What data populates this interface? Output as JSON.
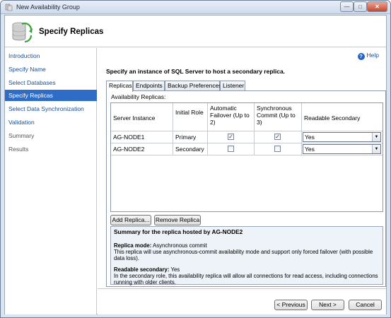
{
  "window": {
    "title": "New Availability Group"
  },
  "header": {
    "title": "Specify Replicas"
  },
  "sidebar": {
    "items": [
      {
        "label": "Introduction"
      },
      {
        "label": "Specify Name"
      },
      {
        "label": "Select Databases"
      },
      {
        "label": "Specify Replicas"
      },
      {
        "label": "Select Data Synchronization"
      },
      {
        "label": "Validation"
      },
      {
        "label": "Summary"
      },
      {
        "label": "Results"
      }
    ],
    "active_item": "Specify Replicas"
  },
  "help": {
    "label": "Help"
  },
  "main": {
    "instruction": "Specify an instance of SQL Server to host a secondary replica.",
    "tabs": [
      {
        "label": "Replicas"
      },
      {
        "label": "Endpoints"
      },
      {
        "label": "Backup Preferences"
      },
      {
        "label": "Listener"
      }
    ],
    "active_tab": "Replicas",
    "group_label": "Availability Replicas:",
    "grid": {
      "headers": {
        "server_instance": "Server Instance",
        "initial_role": "Initial Role",
        "automatic_failover": "Automatic Failover (Up to 2)",
        "synchronous_commit": "Synchronous Commit (Up to 3)",
        "readable_secondary": "Readable Secondary"
      },
      "rows": [
        {
          "server_instance": "AG-NODE1",
          "initial_role": "Primary",
          "automatic_failover": true,
          "synchronous_commit": true,
          "readable_secondary": "Yes"
        },
        {
          "server_instance": "AG-NODE2",
          "initial_role": "Secondary",
          "automatic_failover": false,
          "synchronous_commit": false,
          "readable_secondary": "Yes"
        }
      ]
    },
    "buttons": {
      "add_replica": "Add Replica...",
      "remove_replica": "Remove Replica"
    },
    "summary": {
      "title": "Summary for the replica hosted by AG-NODE2",
      "replica_mode_label": "Replica mode:",
      "replica_mode_value": "Asynchronous commit",
      "replica_mode_desc": "This replica will use asynchronous-commit availability mode and support only forced failover (with possible data loss).",
      "readable_label": "Readable secondary:",
      "readable_value": "Yes",
      "readable_desc": "In the secondary role, this availability replica will allow all connections for read access, including connections running with older clients."
    }
  },
  "footer": {
    "previous": "< Previous",
    "next": "Next >",
    "cancel": "Cancel"
  },
  "colors": {
    "accent": "#2f6cc8",
    "link": "#1a4e95",
    "summary_bg": "#eef3f9"
  },
  "icons": {
    "check": "✓",
    "dropdown": "▼"
  }
}
